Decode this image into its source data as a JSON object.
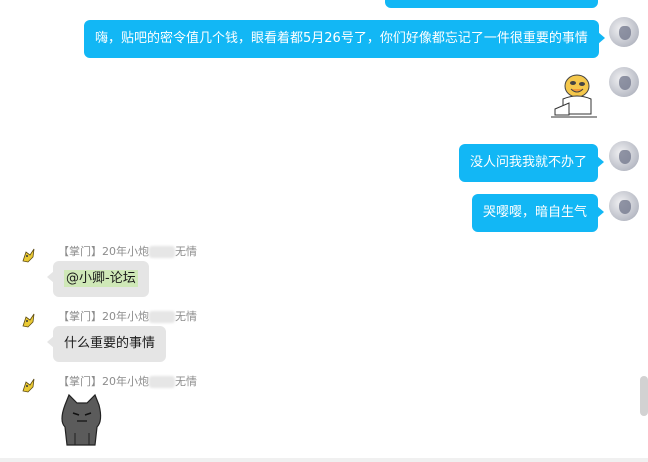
{
  "messages_out": [
    {
      "text": "嗨，贴吧的密令值几个钱，眼看着都5月26号了，你们好像都忘记了一件很重要的事情"
    },
    {
      "text": "没人问我我就不办了"
    },
    {
      "text": "哭嘤嘤，暗自生气"
    }
  ],
  "messages_in": [
    {
      "sender_prefix": "【掌门】20年小炮",
      "sender_suffix": "无情",
      "mention": "@小卿-论坛"
    },
    {
      "sender_prefix": "【掌门】20年小炮",
      "sender_suffix": "无情",
      "text": "什么重要的事情"
    },
    {
      "sender_prefix": "【掌门】20年小炮",
      "sender_suffix": "无情"
    }
  ],
  "colors": {
    "outgoing": "#12b7f5",
    "incoming": "#e5e5e5",
    "mention": "#cfe8b7"
  }
}
